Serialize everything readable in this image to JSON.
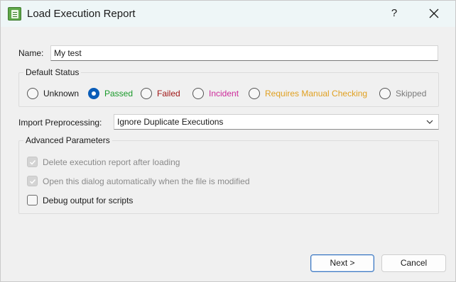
{
  "window": {
    "title": "Load Execution Report",
    "help_label": "?"
  },
  "name": {
    "label": "Name:",
    "value": "My test"
  },
  "default_status": {
    "title": "Default Status",
    "options": [
      {
        "label": "Unknown",
        "color": "#1a1a1a",
        "selected": false
      },
      {
        "label": "Passed",
        "color": "#1a9a2a",
        "selected": true
      },
      {
        "label": "Failed",
        "color": "#a01818",
        "selected": false
      },
      {
        "label": "Incident",
        "color": "#cc2a9a",
        "selected": false
      },
      {
        "label": "Requires Manual Checking",
        "color": "#e0a020",
        "selected": false
      },
      {
        "label": "Skipped",
        "color": "#7a7a7a",
        "selected": false
      }
    ]
  },
  "import_preprocessing": {
    "label": "Import Preprocessing:",
    "selected": "Ignore Duplicate Executions"
  },
  "advanced": {
    "title": "Advanced Parameters",
    "options": [
      {
        "label": "Delete execution report after loading",
        "checked": true,
        "disabled": true
      },
      {
        "label": "Open this dialog automatically when the file is modified",
        "checked": true,
        "disabled": true
      },
      {
        "label": "Debug output for scripts",
        "checked": false,
        "disabled": false
      }
    ]
  },
  "buttons": {
    "next": "Next >",
    "cancel": "Cancel"
  },
  "colors": {
    "accent": "#0a5db8",
    "titlebar": "#eef6f7",
    "disabled_text": "#8a8a8a"
  }
}
